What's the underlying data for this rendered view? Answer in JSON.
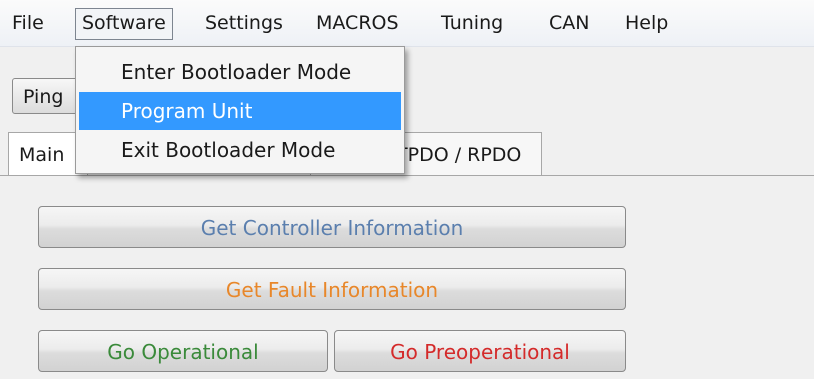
{
  "menubar": {
    "items": [
      "File",
      "Software",
      "Settings",
      "MACROS",
      "Tuning",
      "CAN",
      "Help"
    ]
  },
  "toolbar": {
    "ping_label": "Ping"
  },
  "tabs": [
    {
      "label": "Main"
    },
    {
      "label": "TPDO / RPDO"
    }
  ],
  "software_menu": {
    "items": [
      "Enter Bootloader Mode",
      "Program Unit",
      "Exit Bootloader Mode"
    ],
    "highlighted": "Program Unit"
  },
  "main_panel": {
    "get_controller_info": "Get Controller Information",
    "get_fault_info": "Get Fault Information",
    "go_operational": "Go Operational",
    "go_preoperational": "Go Preoperational"
  },
  "colors": {
    "controller_info_text": "#5b7fae",
    "fault_info_text": "#e8872a",
    "operational_text": "#3a8a3a",
    "preoperational_text": "#d42a2a",
    "menu_highlight": "#3399ff"
  }
}
